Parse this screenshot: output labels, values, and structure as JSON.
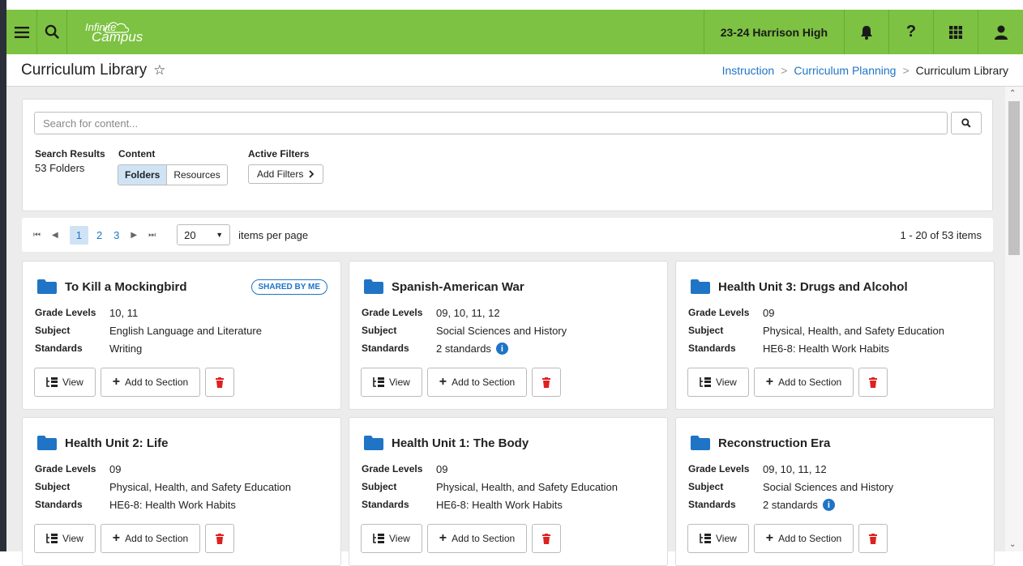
{
  "topbar": {
    "logo_line1": "Infinite",
    "logo_line2": "Campus",
    "school": "23-24 Harrison High",
    "icons": [
      "menu-icon",
      "search-icon",
      "bell-icon",
      "help-icon",
      "apps-grid-icon",
      "user-icon"
    ]
  },
  "header": {
    "title": "Curriculum Library",
    "breadcrumb": [
      "Instruction",
      "Curriculum Planning",
      "Curriculum Library"
    ]
  },
  "search": {
    "placeholder": "Search for content...",
    "results_label": "Search Results",
    "results_value": "53 Folders",
    "content_label": "Content",
    "content_options": [
      "Folders",
      "Resources"
    ],
    "content_selected": "Folders",
    "filters_label": "Active Filters",
    "add_filters": "Add Filters"
  },
  "pager": {
    "pages": [
      "1",
      "2",
      "3"
    ],
    "current_page": "1",
    "per_page": "20",
    "per_page_label": "items per page",
    "range": "1 - 20 of 53 items"
  },
  "labels": {
    "grade_levels": "Grade Levels",
    "subject": "Subject",
    "standards": "Standards",
    "view": "View",
    "add_to_section": "Add to Section"
  },
  "cards": [
    {
      "title": "To Kill a Mockingbird",
      "badge": "SHARED BY ME",
      "grades": "10, 11",
      "subject": "English Language and Literature",
      "standards": "Writing",
      "info": false
    },
    {
      "title": "Spanish-American War",
      "badge": "",
      "grades": "09, 10, 11, 12",
      "subject": "Social Sciences and History",
      "standards": "2 standards",
      "info": true
    },
    {
      "title": "Health Unit 3: Drugs and Alcohol",
      "badge": "",
      "grades": "09",
      "subject": "Physical, Health, and Safety Education",
      "standards": "HE6-8: Health Work Habits",
      "info": false
    },
    {
      "title": "Health Unit 2: Life",
      "badge": "",
      "grades": "09",
      "subject": "Physical, Health, and Safety Education",
      "standards": "HE6-8: Health Work Habits",
      "info": false
    },
    {
      "title": "Health Unit 1: The Body",
      "badge": "",
      "grades": "09",
      "subject": "Physical, Health, and Safety Education",
      "standards": "HE6-8: Health Work Habits",
      "info": false
    },
    {
      "title": "Reconstruction Era",
      "badge": "",
      "grades": "09, 10, 11, 12",
      "subject": "Social Sciences and History",
      "standards": "2 standards",
      "info": true
    }
  ],
  "colors": {
    "topbar": "#7dc242",
    "link": "#1f74c6",
    "folder": "#1f74c6",
    "delete": "#e02020",
    "selected": "#cfe3f5"
  }
}
